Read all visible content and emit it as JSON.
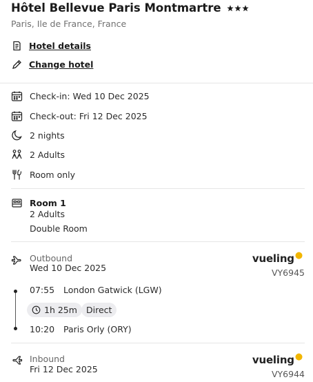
{
  "hotel": {
    "name": "Hôtel Bellevue Paris Montmartre",
    "star_count": 3,
    "location": "Paris, Ile de France, France",
    "details_link": "Hotel details",
    "change_link": "Change hotel"
  },
  "stay": {
    "checkin": "Check-in: Wed 10 Dec 2025",
    "checkout": "Check-out: Fri 12 Dec 2025",
    "nights": "2 nights",
    "guests": "2 Adults",
    "board": "Room only"
  },
  "room": {
    "title": "Room 1",
    "guests": "2 Adults",
    "type": "Double Room"
  },
  "outbound": {
    "label": "Outbound",
    "date": "Wed 10 Dec 2025",
    "airline": "vueling",
    "flight_number": "VY6945",
    "depart_time": "07:55",
    "depart_airport": "London Gatwick (LGW)",
    "duration": "1h 25m",
    "stops": "Direct",
    "arrive_time": "10:20",
    "arrive_airport": "Paris Orly (ORY)"
  },
  "inbound": {
    "label": "Inbound",
    "date": "Fri 12 Dec 2025",
    "airline": "vueling",
    "flight_number": "VY6944"
  },
  "colors": {
    "airline_dot": "#f2b600",
    "chip_bg": "#ececef",
    "muted_text": "#707070"
  }
}
